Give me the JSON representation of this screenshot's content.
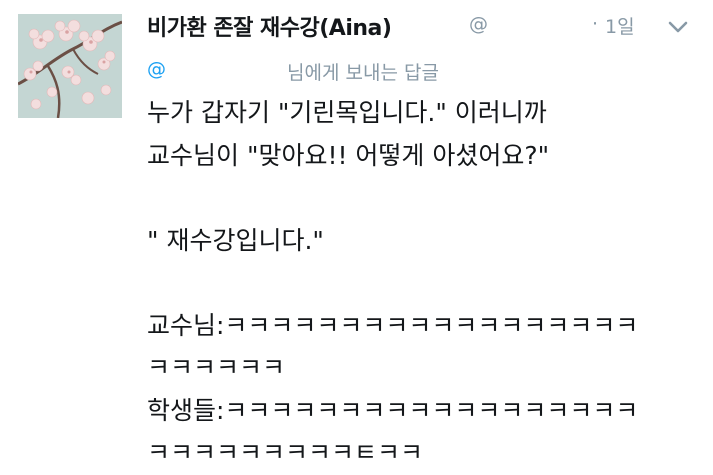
{
  "tweet": {
    "display_name": "비가환 존잘 재수강(Aina)",
    "handle_prefix": "@",
    "dot": "·",
    "time": "1일",
    "reply_prefix": "@",
    "reply_suffix": "님에게 보내는 답글",
    "lines": [
      "누가 갑자기 \"기린목입니다.\" 이러니까",
      "교수님이 \"맞아요!! 어떻게 아셨어요?\"",
      "",
      "\" 재수강입니다.\"",
      "",
      "교수님:ㅋㅋㅋㅋㅋㅋㅋㅋㅋㅋㅋㅋㅋㅋㅋㅋㅋㅋ",
      "ㅋㅋㅋㅋㅋㅋ",
      "학생들:ㅋㅋㅋㅋㅋㅋㅋㅋㅋㅋㅋㅋㅋㅋㅋㅋㅋㅋ",
      "ㅋㅋㅋㅋㅋㅋㅋㅋㅋㅌㅋㅋ"
    ]
  },
  "icons": {
    "avatar": "cherry-blossom-avatar",
    "caret": "chevron-down-icon"
  },
  "colors": {
    "text": "#14171a",
    "muted": "#8899a6",
    "link": "#1da1f2"
  }
}
